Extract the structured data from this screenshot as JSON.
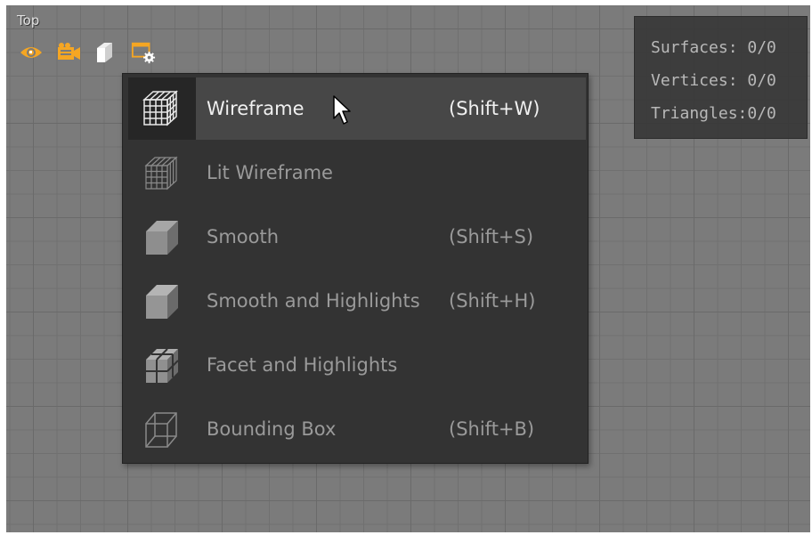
{
  "viewport": {
    "title": "Top",
    "toolbar": [
      {
        "icon": "eye-icon"
      },
      {
        "icon": "camera-icon"
      },
      {
        "icon": "cube-icon"
      },
      {
        "icon": "viewport-settings-icon"
      }
    ]
  },
  "stats": {
    "surfaces": "Surfaces: 0/0",
    "vertices": "Vertices: 0/0",
    "triangles": "Triangles:0/0"
  },
  "menu": {
    "items": [
      {
        "label": "Wireframe",
        "shortcut": "(Shift+W)",
        "icon": "wireframe-cube-icon",
        "hovered": true
      },
      {
        "label": "Lit Wireframe",
        "shortcut": "",
        "icon": "lit-wireframe-cube-icon"
      },
      {
        "label": "Smooth",
        "shortcut": "(Shift+S)",
        "icon": "smooth-cube-icon"
      },
      {
        "label": "Smooth and Highlights",
        "shortcut": "(Shift+H)",
        "icon": "smooth-highlights-cube-icon"
      },
      {
        "label": "Facet and Highlights",
        "shortcut": "",
        "icon": "facet-cube-icon"
      },
      {
        "label": "Bounding Box",
        "shortcut": "(Shift+B)",
        "icon": "bounding-box-icon"
      }
    ]
  },
  "colors": {
    "accent": "#f5a623",
    "menu_bg": "#333333",
    "hover_bg": "#474747"
  }
}
